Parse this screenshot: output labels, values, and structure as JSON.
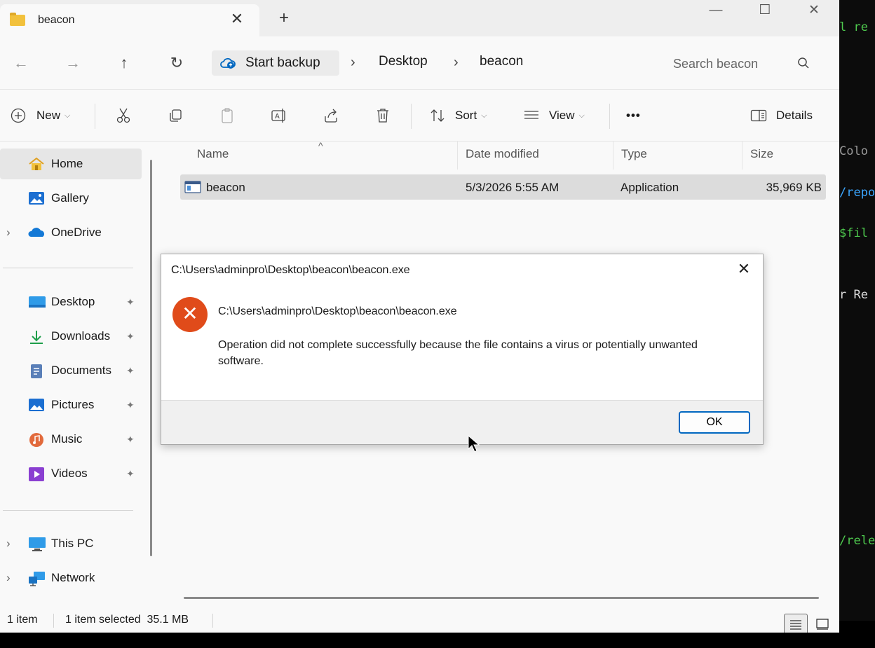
{
  "terminal": {
    "lines": [
      {
        "text": "l re",
        "color": "#4ec94e"
      },
      {
        "text": "Colo",
        "color": "#9a9a9a"
      },
      {
        "text": "/repo",
        "color": "#3ba6ff"
      },
      {
        "text": " $fil",
        "color": "#4ec94e"
      },
      {
        "text": "r Re",
        "color": "#dcdcdc"
      },
      {
        "text": "/rele",
        "color": "#4ec94e"
      }
    ]
  },
  "window": {
    "tab_title": "beacon",
    "tab_close": "✕",
    "new_tab": "+",
    "controls": {
      "minimize": "—",
      "maximize": "☐",
      "close": "✕"
    }
  },
  "address": {
    "back": "←",
    "forward": "→",
    "up": "↑",
    "refresh": "↻",
    "backup_label": "Start backup",
    "separator": "›",
    "crumbs": [
      "Desktop",
      "beacon"
    ],
    "search_placeholder": "Search beacon"
  },
  "toolbar": {
    "new_label": "New",
    "sort_label": "Sort",
    "view_label": "View",
    "more_label": "•••",
    "details_label": "Details"
  },
  "nav": {
    "items": [
      {
        "label": "Home",
        "icon": "home-icon"
      },
      {
        "label": "Gallery",
        "icon": "gallery-icon"
      },
      {
        "label": "OneDrive",
        "icon": "onedrive-icon"
      },
      {
        "label": "Desktop",
        "icon": "desktop-icon"
      },
      {
        "label": "Downloads",
        "icon": "downloads-icon"
      },
      {
        "label": "Documents",
        "icon": "documents-icon"
      },
      {
        "label": "Pictures",
        "icon": "pictures-icon"
      },
      {
        "label": "Music",
        "icon": "music-icon"
      },
      {
        "label": "Videos",
        "icon": "videos-icon"
      },
      {
        "label": "This PC",
        "icon": "this-pc-icon"
      },
      {
        "label": "Network",
        "icon": "network-icon"
      }
    ],
    "pin_glyph": "📌",
    "expand_glyph": "›"
  },
  "filelist": {
    "columns": [
      "Name",
      "Date modified",
      "Type",
      "Size"
    ],
    "sort_caret": "^",
    "rows": [
      {
        "name": "beacon",
        "date": "5/3/2026 5:55 AM",
        "type": "Application",
        "size": "35,969 KB"
      }
    ]
  },
  "status": {
    "count": "1 item",
    "selection": "1 item selected  35.1 MB"
  },
  "dialog": {
    "title": "C:\\Users\\adminpro\\Desktop\\beacon\\beacon.exe",
    "close": "✕",
    "error_glyph": "✕",
    "path": "C:\\Users\\adminpro\\Desktop\\beacon\\beacon.exe",
    "message": "Operation did not complete successfully because the file contains a virus or potentially unwanted software.",
    "ok_label": "OK"
  },
  "colors": {
    "error": "#e04b1a",
    "accent": "#0067c0",
    "selection": "#dcdcdc"
  }
}
